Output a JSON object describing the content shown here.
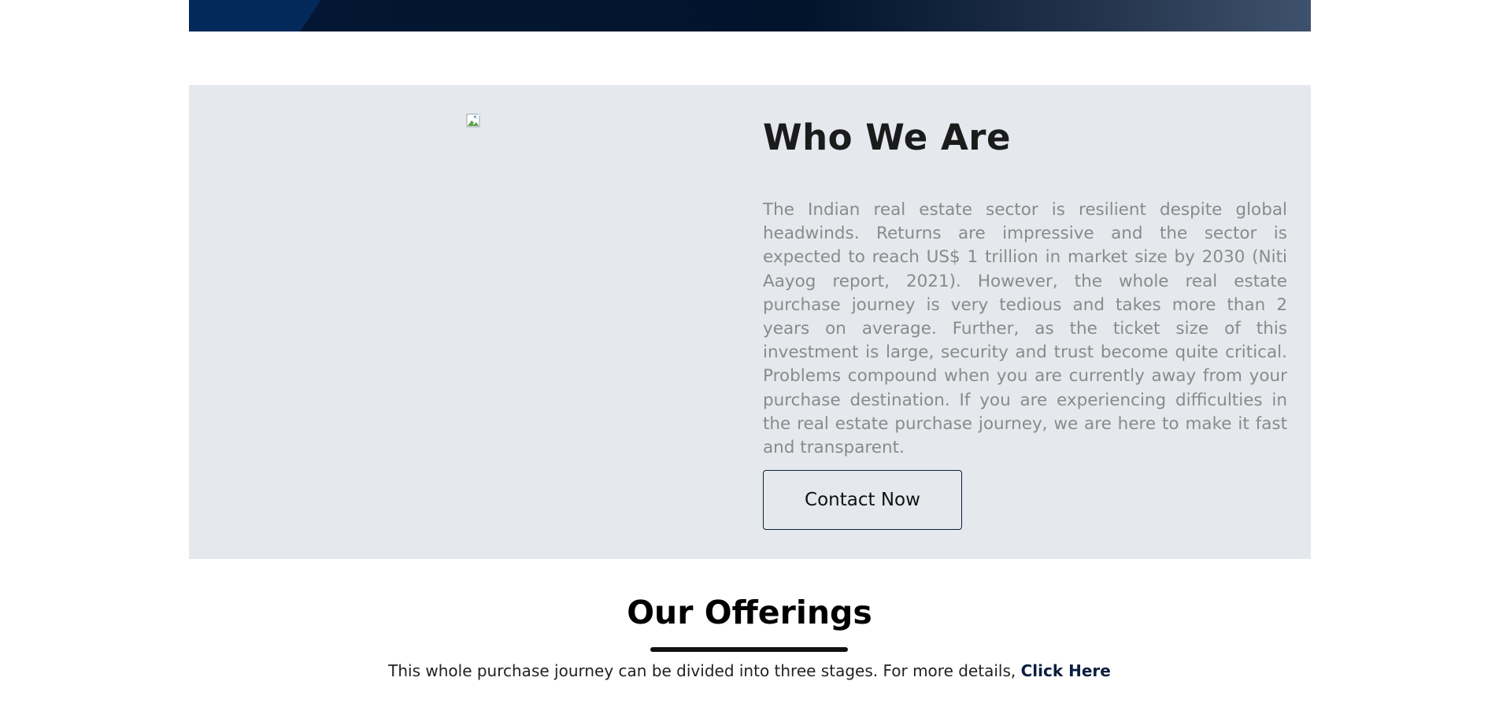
{
  "about": {
    "title": "Who We Are",
    "body": "The Indian real estate sector is resilient despite global headwinds. Returns are impressive and the sector is expected to reach US$ 1 trillion in market size by 2030 (Niti Aayog report, 2021). However, the whole real estate purchase journey is very tedious and takes more than 2 years on average. Further, as the ticket size of this investment is large, security and trust become quite critical. Problems compound when you are currently away from your purchase destination. If you are experiencing difficulties in the real estate purchase journey, we are here to make it fast and transparent.",
    "contact_label": "Contact Now",
    "image_icon": "broken-image-icon"
  },
  "offerings": {
    "title": "Our Offerings",
    "description": "This whole purchase journey can be divided into three stages. For more details,",
    "link_label": "Click Here"
  },
  "colors": {
    "section_bg": "#e5e8ec",
    "brand_dark": "#0b1e40",
    "hero_start": "#041636",
    "hero_end": "#3f526d"
  }
}
